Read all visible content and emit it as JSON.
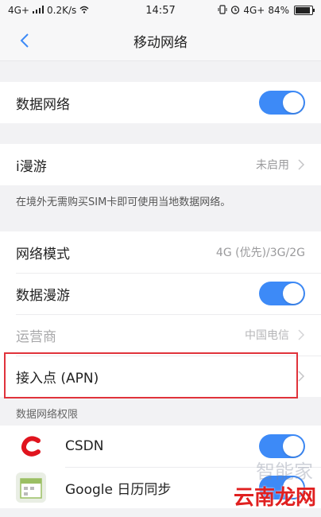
{
  "status_bar": {
    "signal": "4G+",
    "speed": "0.2K/s",
    "time": "14:57",
    "network_right": "4G+",
    "battery": "84%"
  },
  "nav": {
    "title": "移动网络"
  },
  "rows": {
    "mobile_data": {
      "label": "数据网络",
      "enabled": true
    },
    "iroaming": {
      "label": "i漫游",
      "value": "未启用"
    },
    "iroaming_desc": "在境外无需购买SIM卡即可使用当地数据网络。",
    "network_mode": {
      "label": "网络模式",
      "value": "4G (优先)/3G/2G"
    },
    "data_roaming": {
      "label": "数据漫游",
      "enabled": true
    },
    "carrier": {
      "label": "运营商",
      "value": "中国电信"
    },
    "apn": {
      "label": "接入点 (APN)"
    }
  },
  "permissions": {
    "header": "数据网络权限",
    "apps": [
      {
        "name": "CSDN",
        "enabled": true
      },
      {
        "name": "Google 日历同步",
        "enabled": true
      }
    ]
  },
  "watermark": {
    "text": "云南龙网",
    "faint": "智能家"
  },
  "colors": {
    "accent": "#3d8af7",
    "highlight": "#e0333b",
    "background": "#f2f2f4"
  }
}
